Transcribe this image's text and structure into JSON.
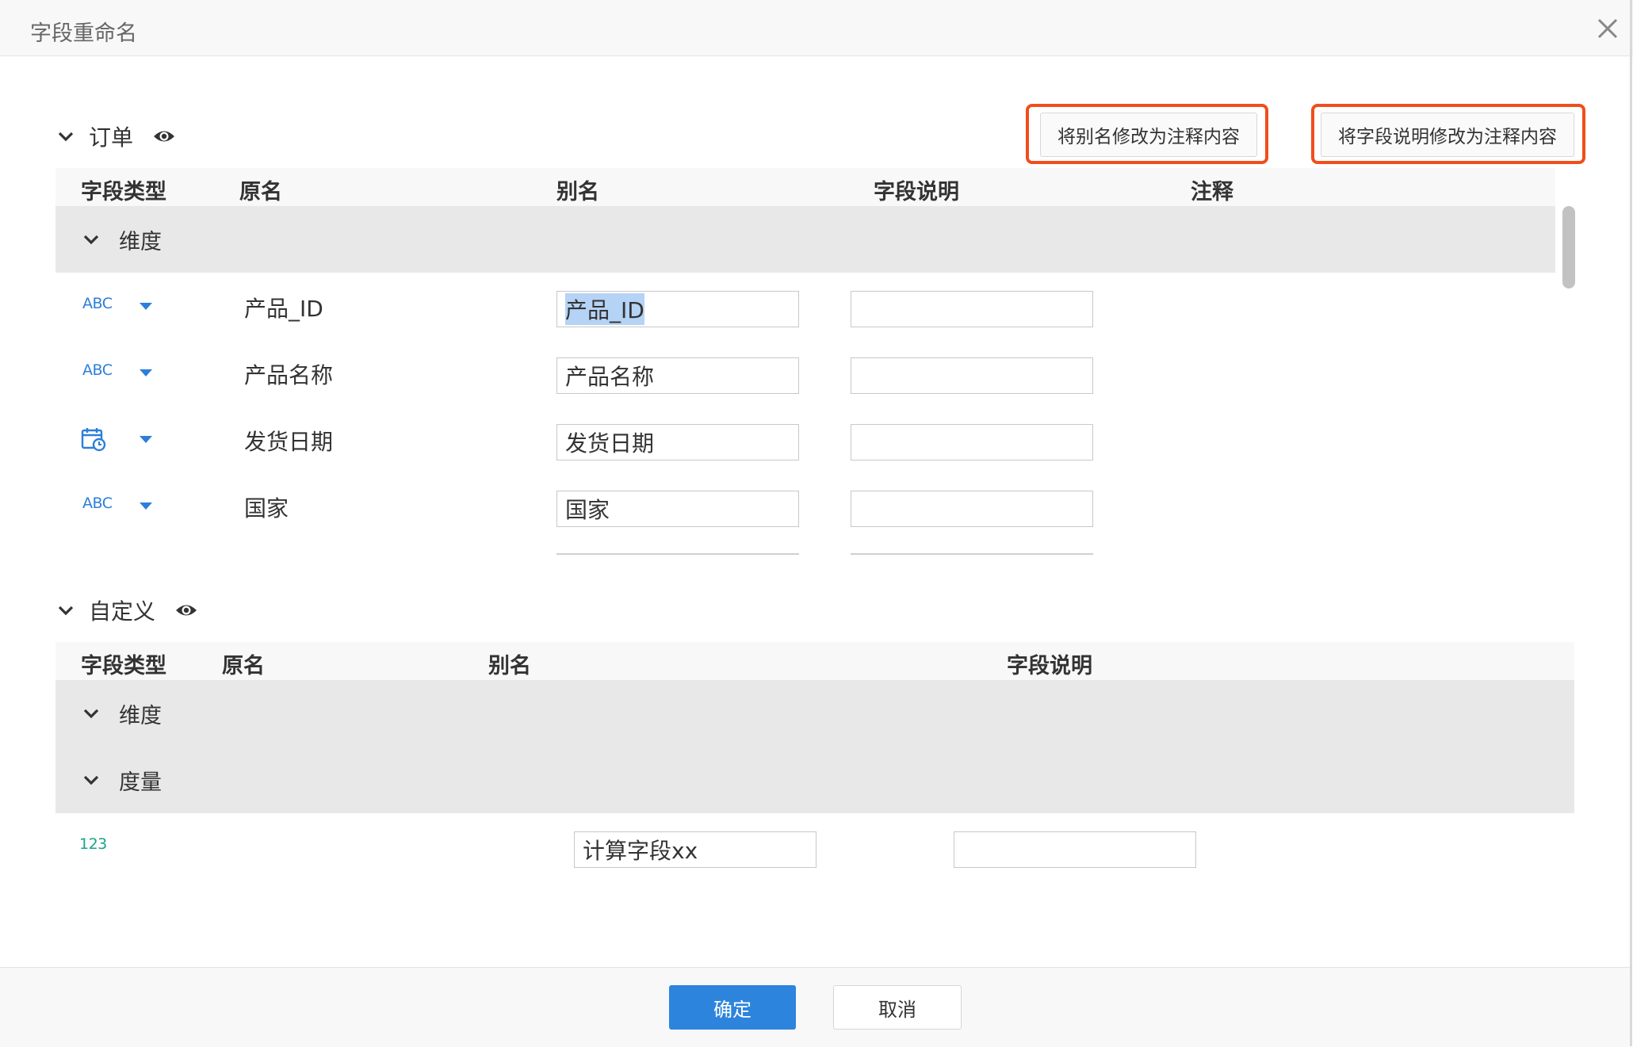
{
  "dialog": {
    "title": "字段重命名",
    "close_icon": "close-icon"
  },
  "actions": {
    "alias_to_comment": "将别名修改为注释内容",
    "desc_to_comment": "将字段说明修改为注释内容",
    "highlight_color": "#f04e1c"
  },
  "section_orders": {
    "title": "订单",
    "visibility_icon": "eye-icon",
    "columns": [
      "字段类型",
      "原名",
      "别名",
      "字段说明",
      "注释"
    ],
    "group_label": "维度",
    "rows": [
      {
        "type_icon": "ABC",
        "original": "产品_ID",
        "alias": "产品_ID",
        "description": ""
      },
      {
        "type_icon": "ABC",
        "original": "产品名称",
        "alias": "产品名称",
        "description": ""
      },
      {
        "type_icon": "calendar-icon",
        "original": "发货日期",
        "alias": "发货日期",
        "description": ""
      },
      {
        "type_icon": "ABC",
        "original": "国家",
        "alias": "国家",
        "description": ""
      }
    ]
  },
  "section_custom": {
    "title": "自定义",
    "visibility_icon": "eye-icon",
    "columns": [
      "字段类型",
      "原名",
      "别名",
      "字段说明"
    ],
    "groups": [
      "维度",
      "度量"
    ],
    "rows": [
      {
        "type_icon": "123",
        "original": "",
        "alias": "计算字段xx",
        "description": ""
      }
    ]
  },
  "footer": {
    "confirm": "确定",
    "cancel": "取消",
    "accent": "#2d84dd"
  }
}
